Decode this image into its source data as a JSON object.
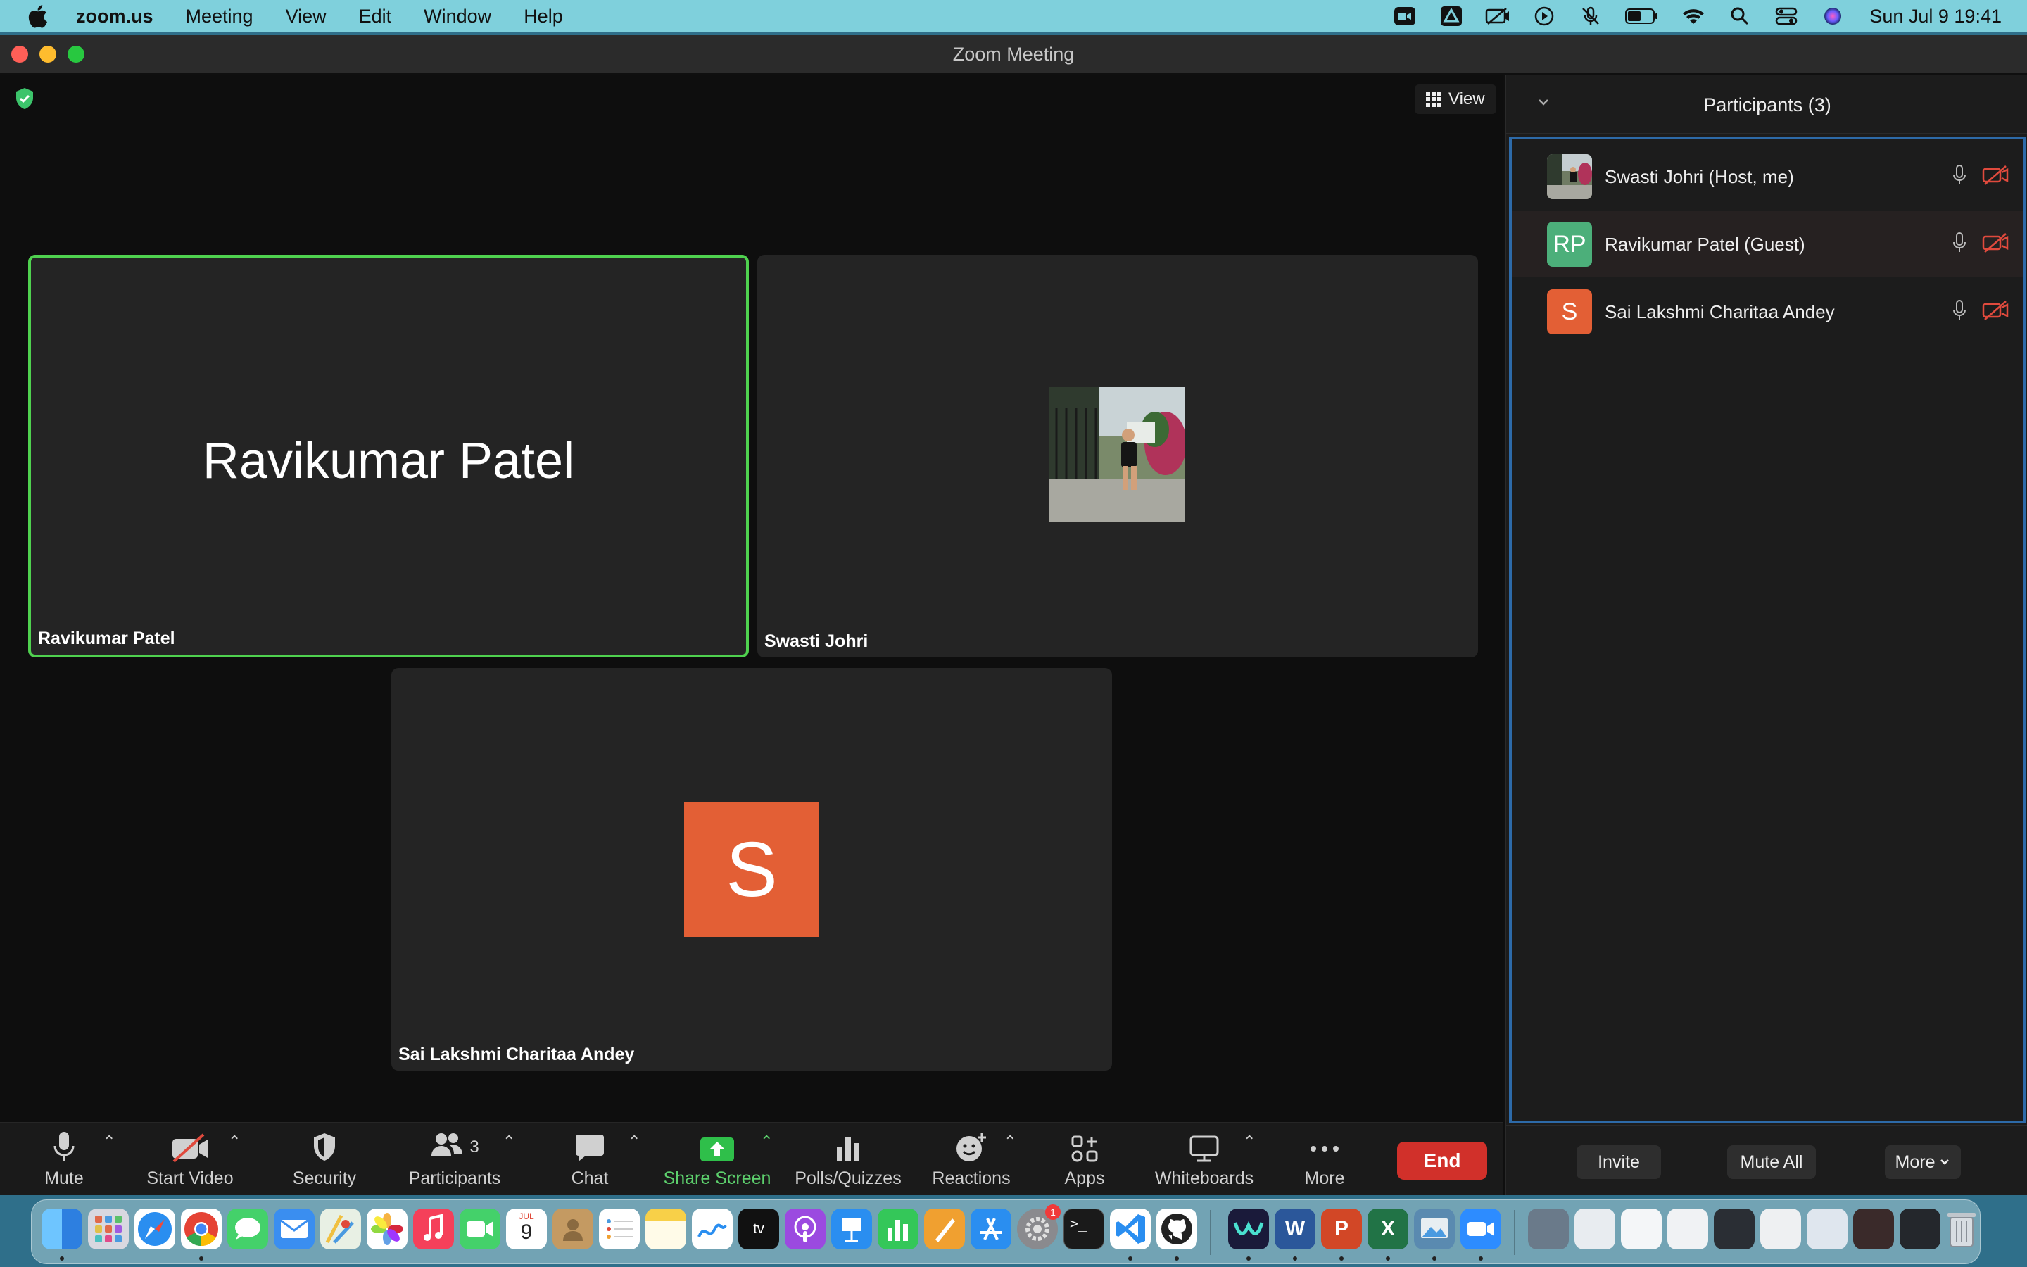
{
  "menubar": {
    "app_name": "zoom.us",
    "menus": [
      "Meeting",
      "View",
      "Edit",
      "Window",
      "Help"
    ],
    "clock": "Sun Jul 9  19:41",
    "status_icons": [
      "zoom-status-icon",
      "drive-icon",
      "captions-icon",
      "play-icon",
      "mute-icon",
      "battery-icon",
      "wifi-icon",
      "spotlight-icon",
      "control-center-icon",
      "siri-icon"
    ]
  },
  "window": {
    "title": "Zoom Meeting"
  },
  "video": {
    "view_label": "View",
    "tiles": [
      {
        "big_name": "Ravikumar Patel",
        "label": "Ravikumar Patel",
        "active_speaker": true
      },
      {
        "label": "Swasti Johri"
      },
      {
        "avatar_letter": "S",
        "label": "Sai Lakshmi Charitaa Andey"
      }
    ]
  },
  "toolbar": {
    "mute": "Mute",
    "start_video": "Start Video",
    "security": "Security",
    "participants": "Participants",
    "participants_count": "3",
    "chat": "Chat",
    "share_screen": "Share Screen",
    "polls": "Polls/Quizzes",
    "reactions": "Reactions",
    "apps": "Apps",
    "whiteboards": "Whiteboards",
    "more": "More",
    "end": "End"
  },
  "participants_panel": {
    "title": "Participants (3)",
    "rows": [
      {
        "name": "Swasti Johri (Host, me)",
        "avatar_type": "photo"
      },
      {
        "name": "Ravikumar Patel (Guest)",
        "avatar_initials": "RP",
        "avatar_color": "#4caf7a"
      },
      {
        "name": "Sai Lakshmi Charitaa Andey",
        "avatar_initials": "S",
        "avatar_color": "#e35f35"
      }
    ],
    "invite": "Invite",
    "mute_all": "Mute All",
    "more": "More"
  },
  "dock": {
    "calendar_month": "JUL",
    "calendar_day": "9",
    "settings_badge": "1"
  },
  "colors": {
    "active_speaker_border": "#4fd14f",
    "end_button": "#d1302a",
    "share_screen": "#5dd06d",
    "panel_focus_border": "#2d6aa8"
  }
}
